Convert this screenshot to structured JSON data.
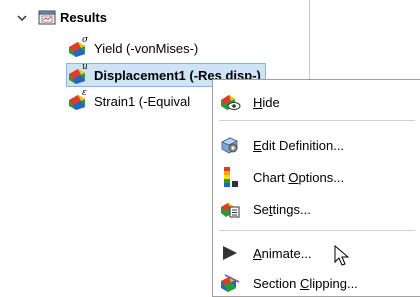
{
  "tree": {
    "results_label": "Results",
    "items": [
      {
        "label": "Yield (-vonMises-)",
        "superscript": "σ",
        "selected": false
      },
      {
        "label": "Displacement1 (-Res disp-)",
        "superscript": "u",
        "selected": true
      },
      {
        "label": "Strain1 (-Equival",
        "superscript": "ε",
        "selected": false
      }
    ]
  },
  "context_menu": {
    "items": [
      {
        "label": "Hide",
        "accelerator_index": 0,
        "icon": "hide-icon"
      },
      {
        "label": "Edit Definition...",
        "accelerator_index": 0,
        "icon": "edit-definition-icon"
      },
      {
        "label": "Chart Options...",
        "accelerator_index": 6,
        "icon": "chart-options-icon"
      },
      {
        "label": "Settings...",
        "accelerator_index": 2,
        "icon": "settings-icon"
      },
      {
        "label": "Animate...",
        "accelerator_index": 0,
        "icon": "play-icon"
      },
      {
        "label": "Section Clipping...",
        "accelerator_index": 8,
        "icon": "section-clipping-icon"
      }
    ]
  },
  "colors": {
    "selection_bg": "#cfe3f7",
    "selection_border": "#8ab4df",
    "menu_border": "#a0a0a0"
  }
}
